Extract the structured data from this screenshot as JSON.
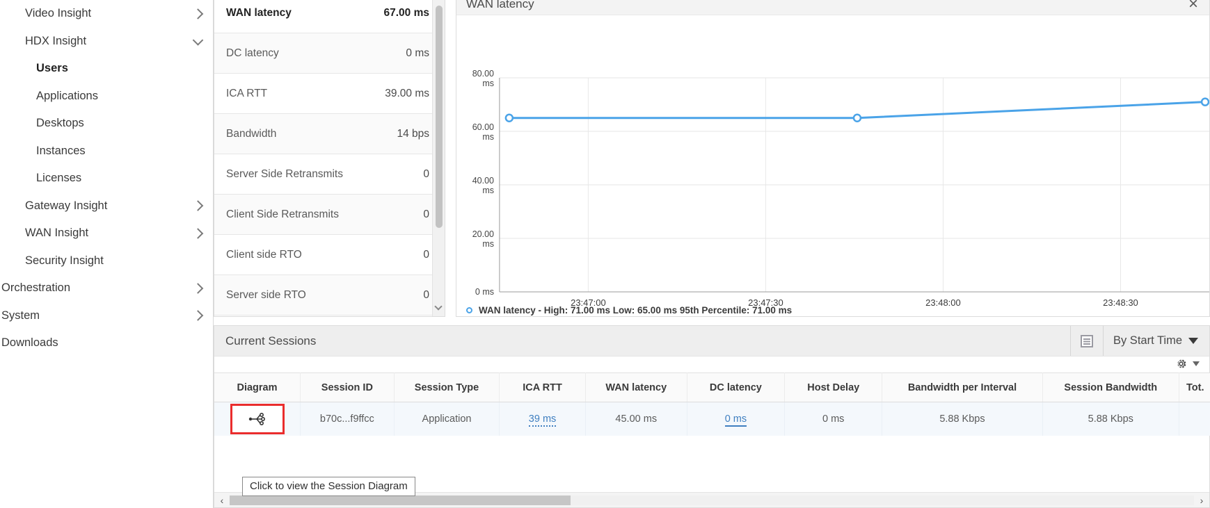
{
  "sidebar": {
    "items": [
      {
        "label": "Video Insight",
        "level": 1,
        "chevron": "right",
        "selected": false
      },
      {
        "label": "HDX Insight",
        "level": 1,
        "chevron": "down",
        "selected": false
      },
      {
        "label": "Users",
        "level": 2,
        "chevron": "none",
        "selected": true
      },
      {
        "label": "Applications",
        "level": 2,
        "chevron": "none",
        "selected": false
      },
      {
        "label": "Desktops",
        "level": 2,
        "chevron": "none",
        "selected": false
      },
      {
        "label": "Instances",
        "level": 2,
        "chevron": "none",
        "selected": false
      },
      {
        "label": "Licenses",
        "level": 2,
        "chevron": "none",
        "selected": false
      },
      {
        "label": "Gateway Insight",
        "level": 1,
        "chevron": "right",
        "selected": false
      },
      {
        "label": "WAN Insight",
        "level": 1,
        "chevron": "right",
        "selected": false
      },
      {
        "label": "Security Insight",
        "level": 1,
        "chevron": "none",
        "selected": false
      },
      {
        "label": "Orchestration",
        "level": 0,
        "chevron": "right",
        "selected": false
      },
      {
        "label": "System",
        "level": 0,
        "chevron": "right",
        "selected": false
      },
      {
        "label": "Downloads",
        "level": 0,
        "chevron": "none",
        "selected": false
      }
    ]
  },
  "metrics": {
    "rows": [
      {
        "name": "WAN latency",
        "value": "67.00 ms"
      },
      {
        "name": "DC latency",
        "value": "0 ms"
      },
      {
        "name": "ICA RTT",
        "value": "39.00 ms"
      },
      {
        "name": "Bandwidth",
        "value": "14 bps"
      },
      {
        "name": "Server Side Retransmits",
        "value": "0"
      },
      {
        "name": "Client Side Retransmits",
        "value": "0"
      },
      {
        "name": "Client side RTO",
        "value": "0"
      },
      {
        "name": "Server side RTO",
        "value": "0"
      }
    ]
  },
  "chart_panel": {
    "title": "WAN latency",
    "close_label": "×"
  },
  "chart_data": {
    "type": "line",
    "title": "WAN latency",
    "xlabel": "",
    "ylabel": "ms",
    "ylim": [
      0,
      80
    ],
    "yticks": [
      0,
      20,
      40,
      60,
      80
    ],
    "ytick_labels": [
      "0 ms",
      "20.00\nms",
      "40.00\nms",
      "60.00\nms",
      "80.00\nms"
    ],
    "xtick_labels": [
      "23:47:00",
      "23:47:30",
      "23:48:00",
      "23:48:30"
    ],
    "grid": true,
    "legend_position": "bottom-left",
    "series": [
      {
        "name": "WAN latency",
        "color": "#4aa3e8",
        "x": [
          "23:46:45",
          "23:47:35",
          "23:48:45"
        ],
        "values": [
          65,
          65,
          71
        ],
        "markers": [
          true,
          true,
          true
        ]
      }
    ],
    "legend_text": "WAN latency - High: 71.00 ms Low: 65.00 ms 95th Percentile: 71.00 ms",
    "annotations": {
      "high": "71.00 ms",
      "low": "65.00 ms",
      "percentile_95": "71.00 ms"
    }
  },
  "sessions": {
    "title": "Current Sessions",
    "grid_icon": "list-view-icon",
    "sort_label": "By Start Time",
    "settings_icon": "gear-icon",
    "columns": [
      "Diagram",
      "Session ID",
      "Session Type",
      "ICA RTT",
      "WAN latency",
      "DC latency",
      "Host Delay",
      "Bandwidth per Interval",
      "Session Bandwidth",
      "Tot."
    ],
    "rows": [
      {
        "diagram_icon": "session-diagram-icon",
        "session_id": "b70c...f9ffcc",
        "session_type": "Application",
        "ica_rtt": "39 ms",
        "wan_latency": "45.00 ms",
        "dc_latency": "0 ms",
        "host_delay": "0 ms",
        "bandwidth_per_interval": "5.88 Kbps",
        "session_bandwidth": "5.88 Kbps",
        "total": ""
      }
    ],
    "tooltip": "Click to view the Session Diagram",
    "scroll_left_icon": "‹",
    "scroll_right_icon": "›"
  },
  "colors": {
    "accent": "#4aa3e8",
    "link": "#3f7fc0",
    "highlight": "#ea2d2d",
    "row_bg": "#f4f8fc"
  }
}
